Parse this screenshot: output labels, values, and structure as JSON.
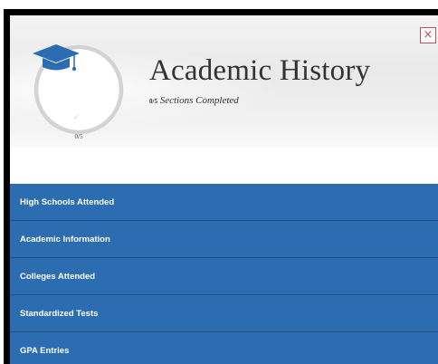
{
  "header": {
    "title": "Academic History",
    "completed_count": "0/5",
    "completed_suffix": "Sections Completed",
    "progress_label": "0/5",
    "progress": {
      "completed": 0,
      "total": 5
    },
    "close_label": "×"
  },
  "icons": {
    "section_icon": "graduation-cap-icon",
    "close_icon": "close-icon",
    "check_icon": "check-icon"
  },
  "colors": {
    "nav_background": "#2c6db2",
    "icon_blue": "#2c6db2",
    "close_red": "#c9485b"
  },
  "nav": {
    "items": [
      {
        "label": "High Schools Attended"
      },
      {
        "label": "Academic Information"
      },
      {
        "label": "Colleges Attended"
      },
      {
        "label": "Standardized Tests"
      },
      {
        "label": "GPA Entries"
      }
    ]
  }
}
